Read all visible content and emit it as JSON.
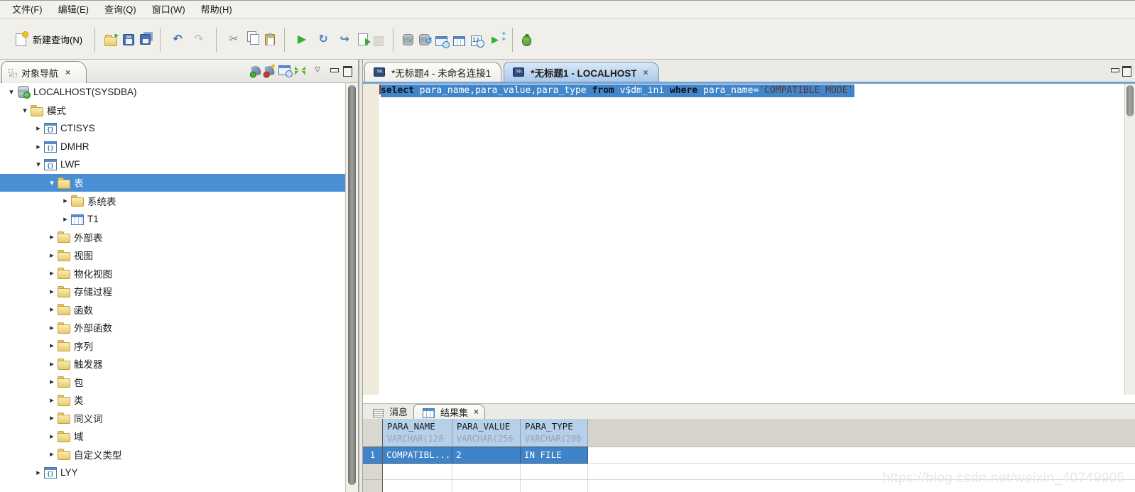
{
  "window": {
    "watermark": "https://blog.csdn.net/weixin_40749905"
  },
  "colors": {
    "editor_selection_blue": "#4186c9",
    "tree_selection_blue": "#4a8fd3",
    "table_header_blue": "#b7d0ea",
    "run_green": "#2fae33",
    "folder_yellow": "#e9c969",
    "active_tab_blue": "#a9c9ea"
  },
  "menu_bar": {
    "items": [
      "文件(F)",
      "编辑(E)",
      "查询(Q)",
      "窗口(W)",
      "帮助(H)"
    ]
  },
  "toolbar": {
    "groups": [
      {
        "items": [
          {
            "name": "new-query-button",
            "label": "新建查询(N)",
            "icon": "new-query-icon"
          }
        ]
      },
      {
        "items": [
          {
            "name": "open-file-icon",
            "kind": "folder-open"
          },
          {
            "name": "save-icon",
            "kind": "floppy"
          },
          {
            "name": "save-all-icon",
            "kind": "floppy-multi"
          }
        ]
      },
      {
        "items": [
          {
            "name": "undo-icon",
            "glyph": "↶",
            "color": "#3a6fc4"
          },
          {
            "name": "redo-icon",
            "glyph": "↷",
            "color": "#9a9a92",
            "disabled": true
          }
        ]
      },
      {
        "items": [
          {
            "name": "cut-icon",
            "glyph": "✂",
            "color": "#6f8fb5"
          },
          {
            "name": "copy-icon",
            "kind": "copy"
          },
          {
            "name": "paste-icon",
            "kind": "paste"
          }
        ]
      },
      {
        "items": [
          {
            "name": "execute-icon",
            "glyph": "▶",
            "color": "#2fae33"
          },
          {
            "name": "execute-current-icon",
            "glyph": "↻",
            "color": "#4a7fc1"
          },
          {
            "name": "step-execute-icon",
            "glyph": "↪",
            "color": "#4a7fc1"
          },
          {
            "name": "execute-script-icon",
            "kind": "doc-play"
          },
          {
            "name": "stop-icon",
            "kind": "stop-disabled",
            "disabled": true
          }
        ]
      },
      {
        "items": [
          {
            "name": "commit-icon",
            "kind": "db db-check"
          },
          {
            "name": "rollback-icon",
            "kind": "db db-undo"
          },
          {
            "name": "query-info-window-icon",
            "kind": "win-clock"
          },
          {
            "name": "result-grid-icon",
            "kind": "grid"
          },
          {
            "name": "explain-plan-icon",
            "kind": "plan"
          },
          {
            "name": "batch-execute-icon",
            "kind": "run-plus"
          }
        ]
      },
      {
        "items": [
          {
            "name": "debug-icon",
            "kind": "bug"
          }
        ]
      }
    ]
  },
  "object_nav": {
    "title": "对象导航",
    "close_glyph": "×",
    "header_icons": [
      {
        "name": "connect-icon",
        "kind": "plug"
      },
      {
        "name": "disconnect-icon",
        "kind": "plug plug-red"
      },
      {
        "name": "console-window-icon",
        "kind": "win-clock"
      },
      {
        "name": "expand-collapse-all-icon",
        "kind": "expand-all"
      },
      {
        "name": "view-menu-icon",
        "kind": "chevron",
        "glyph": "▽"
      },
      {
        "name": "minimize-panel-icon",
        "kind": "minbox"
      },
      {
        "name": "maximize-panel-icon",
        "kind": "maxbox"
      }
    ],
    "tree": {
      "items": [
        {
          "label": "LOCALHOST(SYSDBA)",
          "level": 0,
          "expanded": true,
          "icon": "database",
          "selected": false
        },
        {
          "label": "模式",
          "level": 1,
          "expanded": true,
          "icon": "folder",
          "selected": false
        },
        {
          "label": "CTISYS",
          "level": 2,
          "expanded": false,
          "icon": "schema",
          "selected": false
        },
        {
          "label": "DMHR",
          "level": 2,
          "expanded": false,
          "icon": "schema",
          "selected": false
        },
        {
          "label": "LWF",
          "level": 2,
          "expanded": true,
          "icon": "schema",
          "selected": false
        },
        {
          "label": "表",
          "level": 3,
          "expanded": true,
          "icon": "folder",
          "selected": true
        },
        {
          "label": "系统表",
          "level": 4,
          "expanded": false,
          "icon": "folder",
          "selected": false
        },
        {
          "label": "T1",
          "level": 4,
          "expanded": false,
          "icon": "table",
          "selected": false
        },
        {
          "label": "外部表",
          "level": 3,
          "expanded": false,
          "icon": "folder",
          "selected": false
        },
        {
          "label": "视图",
          "level": 3,
          "expanded": false,
          "icon": "folder",
          "selected": false
        },
        {
          "label": "物化视图",
          "level": 3,
          "expanded": false,
          "icon": "folder",
          "selected": false
        },
        {
          "label": "存储过程",
          "level": 3,
          "expanded": false,
          "icon": "folder",
          "selected": false
        },
        {
          "label": "函数",
          "level": 3,
          "expanded": false,
          "icon": "folder",
          "selected": false
        },
        {
          "label": "外部函数",
          "level": 3,
          "expanded": false,
          "icon": "folder",
          "selected": false
        },
        {
          "label": "序列",
          "level": 3,
          "expanded": false,
          "icon": "folder",
          "selected": false
        },
        {
          "label": "触发器",
          "level": 3,
          "expanded": false,
          "icon": "folder",
          "selected": false
        },
        {
          "label": "包",
          "level": 3,
          "expanded": false,
          "icon": "folder",
          "selected": false
        },
        {
          "label": "类",
          "level": 3,
          "expanded": false,
          "icon": "folder",
          "selected": false
        },
        {
          "label": "同义词",
          "level": 3,
          "expanded": false,
          "icon": "folder",
          "selected": false
        },
        {
          "label": "域",
          "level": 3,
          "expanded": false,
          "icon": "folder",
          "selected": false
        },
        {
          "label": "自定义类型",
          "level": 3,
          "expanded": false,
          "icon": "folder",
          "selected": false
        },
        {
          "label": "LYY",
          "level": 2,
          "expanded": false,
          "icon": "schema",
          "selected": false
        }
      ]
    }
  },
  "editor": {
    "tabs": [
      {
        "label": "*无标题4 - 未命名连接1",
        "active": false
      },
      {
        "label": "*无标题1 - LOCALHOST",
        "active": true,
        "close_glyph": "×"
      }
    ],
    "sql": {
      "tokens": [
        {
          "type": "kw",
          "text": "select "
        },
        {
          "type": "plain",
          "text": "para_name,para_value,para_type "
        },
        {
          "type": "kw",
          "text": "from "
        },
        {
          "type": "plain",
          "text": "v$dm_ini "
        },
        {
          "type": "kw",
          "text": "where "
        },
        {
          "type": "plain",
          "text": "para_name="
        },
        {
          "type": "str",
          "text": "'COMPATIBLE_MODE'"
        }
      ]
    }
  },
  "results_panel": {
    "tabs": [
      {
        "label": "消息",
        "icon": "message-icon",
        "active": false
      },
      {
        "label": "结果集",
        "icon": "result-grid-icon",
        "active": true,
        "close_glyph": "×"
      }
    ],
    "corner_icons": [
      {
        "name": "clear-results-icon",
        "kind": "xx",
        "glyph": "××"
      },
      {
        "name": "toggle-view-icon",
        "kind": "swap",
        "glyph": "⇄"
      },
      {
        "name": "maximize-panel-icon",
        "kind": "maxbox"
      }
    ],
    "table": {
      "columns": [
        {
          "name": "PARA_NAME",
          "type": "VARCHAR(128"
        },
        {
          "name": "PARA_VALUE",
          "type": "VARCHAR(256"
        },
        {
          "name": "PARA_TYPE",
          "type": "VARCHAR(200"
        }
      ],
      "rows": [
        {
          "num": "1",
          "cells": [
            "COMPATIBL...",
            "2",
            "IN FILE"
          ],
          "selected": true
        }
      ],
      "empty_row_count": 2
    }
  }
}
